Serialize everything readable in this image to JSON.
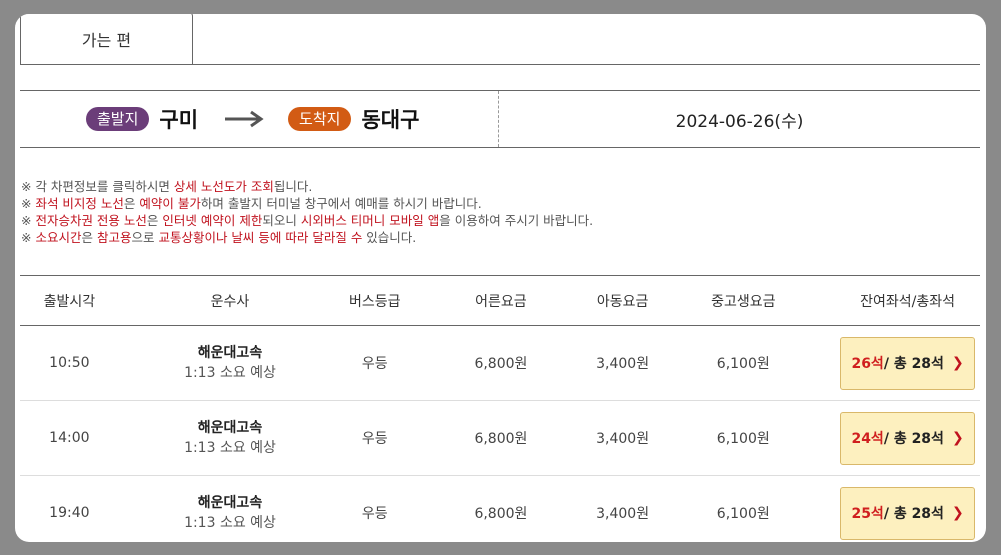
{
  "tabs": [
    {
      "label": "가는 편",
      "active": true
    }
  ],
  "route": {
    "departure_badge": "출발지",
    "departure_city": "구미",
    "arrival_badge": "도착지",
    "arrival_city": "동대구",
    "date": "2024-06-26(수)"
  },
  "colors": {
    "departure_badge": "#6b3d79",
    "arrival_badge": "#d25b14",
    "highlight": "#c0121e",
    "seat_button_bg": "#fdf0bf"
  },
  "notices": [
    [
      {
        "t": "※ 각 차편정보를 클릭하시면 ",
        "hl": false
      },
      {
        "t": "상세 노선도가 조회",
        "hl": true
      },
      {
        "t": "됩니다.",
        "hl": false
      }
    ],
    [
      {
        "t": "※ ",
        "hl": false
      },
      {
        "t": "좌석 비지정 노선",
        "hl": true
      },
      {
        "t": "은 ",
        "hl": false
      },
      {
        "t": "예약이 불가",
        "hl": true
      },
      {
        "t": "하며 출발지 터미널 창구에서 예매를 하시기 바랍니다.",
        "hl": false
      }
    ],
    [
      {
        "t": "※ ",
        "hl": false
      },
      {
        "t": "전자승차권 전용 노선",
        "hl": true
      },
      {
        "t": "은 ",
        "hl": false
      },
      {
        "t": "인터넷 예약이 제한",
        "hl": true
      },
      {
        "t": "되오니 ",
        "hl": false
      },
      {
        "t": "시외버스 티머니 모바일 앱",
        "hl": true
      },
      {
        "t": "을 이용하여 주시기 바랍니다.",
        "hl": false
      }
    ],
    [
      {
        "t": "※ ",
        "hl": false
      },
      {
        "t": "소요시간",
        "hl": true
      },
      {
        "t": "은 ",
        "hl": false
      },
      {
        "t": "참고용",
        "hl": true
      },
      {
        "t": "으로 ",
        "hl": false
      },
      {
        "t": "교통상황이나 날씨 등에 따라 달라질 수",
        "hl": true
      },
      {
        "t": " 있습니다.",
        "hl": false
      }
    ]
  ],
  "table": {
    "headers": [
      "출발시각",
      "운수사",
      "버스등급",
      "어른요금",
      "아동요금",
      "중고생요금",
      "잔여좌석/총좌석"
    ],
    "rows": [
      {
        "time": "10:50",
        "company": "해운대고속",
        "duration": "1:13 소요 예상",
        "grade": "우등",
        "adult": "6,800원",
        "child": "3,400원",
        "teen": "6,100원",
        "remain": "26석",
        "total": " / 총 28석"
      },
      {
        "time": "14:00",
        "company": "해운대고속",
        "duration": "1:13 소요 예상",
        "grade": "우등",
        "adult": "6,800원",
        "child": "3,400원",
        "teen": "6,100원",
        "remain": "24석",
        "total": " / 총 28석"
      },
      {
        "time": "19:40",
        "company": "해운대고속",
        "duration": "1:13 소요 예상",
        "grade": "우등",
        "adult": "6,800원",
        "child": "3,400원",
        "teen": "6,100원",
        "remain": "25석",
        "total": " / 총 28석"
      }
    ]
  },
  "icons": {
    "route_arrow": "arrow-right-icon",
    "seat_chevron": "chevron-right-icon",
    "seat_chevron_glyph": "❯"
  }
}
